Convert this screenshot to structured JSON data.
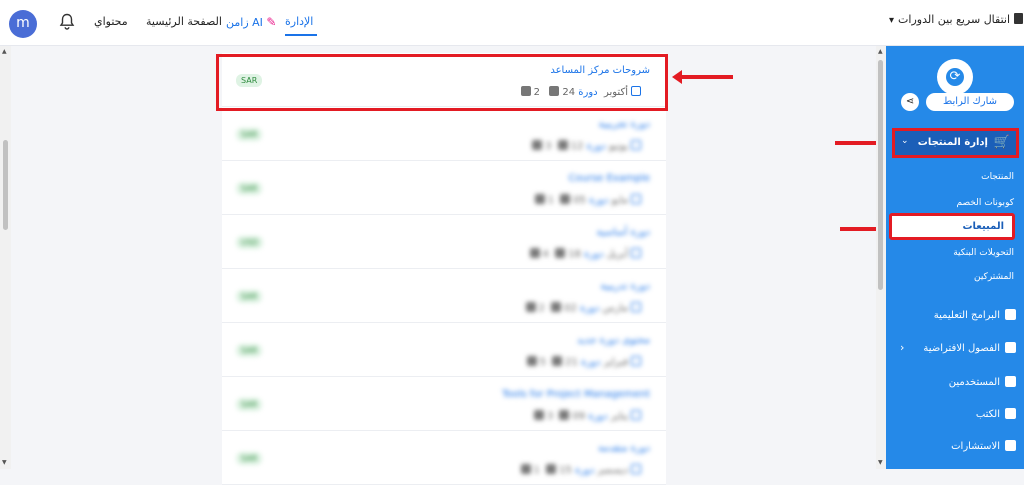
{
  "topbar": {
    "avatar_letter": "m",
    "nav": {
      "my_content": "محتواي",
      "home": "الصفحة الرئيسية",
      "zamn_ai": "زامن AI",
      "admin": "الإدارة"
    },
    "quick_switch": "انتقال سريع بين الدورات"
  },
  "sidebar": {
    "share_label": "شارك الرابط",
    "products_mgmt": "إدارة المنتجات",
    "sub_items": [
      "المنتجات",
      "كوبونات الخصم",
      "المبيعات",
      "التحويلات البنكية",
      "المشتركين"
    ],
    "menu": [
      "البرامج التعليمية",
      "الفصول الافتراضية",
      "المستخدمين",
      "الكتب",
      "الاستشارات"
    ]
  },
  "list": {
    "cards": [
      {
        "title": "شروحات مركز المساعد",
        "kind": "دورة",
        "date": "24 أكتوبر",
        "count": "2",
        "currency": "SAR",
        "blurred": false
      },
      {
        "title": "دورة تجريبية",
        "kind": "دورة",
        "date": "12 يونيو",
        "count": "3",
        "currency": "SAR",
        "blurred": true
      },
      {
        "title": "Course Example",
        "kind": "دورة",
        "date": "05 مايو",
        "count": "1",
        "currency": "SAR",
        "blurred": true
      },
      {
        "title": "دورة أساسية",
        "kind": "دورة",
        "date": "18 أبريل",
        "count": "4",
        "currency": "USD",
        "blurred": true
      },
      {
        "title": "دورة تدريبية",
        "kind": "دورة",
        "date": "02 مارس",
        "count": "2",
        "currency": "SAR",
        "blurred": true
      },
      {
        "title": "محتوى دورة جديد",
        "kind": "دورة",
        "date": "21 فبراير",
        "count": "5",
        "currency": "SAR",
        "blurred": true
      },
      {
        "title": "Tools for Project Management",
        "kind": "دورة",
        "date": "09 يناير",
        "count": "3",
        "currency": "SAR",
        "blurred": true
      },
      {
        "title": "دورة متقدمة",
        "kind": "دورة",
        "date": "15 ديسمبر",
        "count": "1",
        "currency": "SAR",
        "blurred": true
      }
    ]
  },
  "colors": {
    "accent": "#1a73e8",
    "sidebar": "#2589e8",
    "highlight": "#e31b23"
  }
}
